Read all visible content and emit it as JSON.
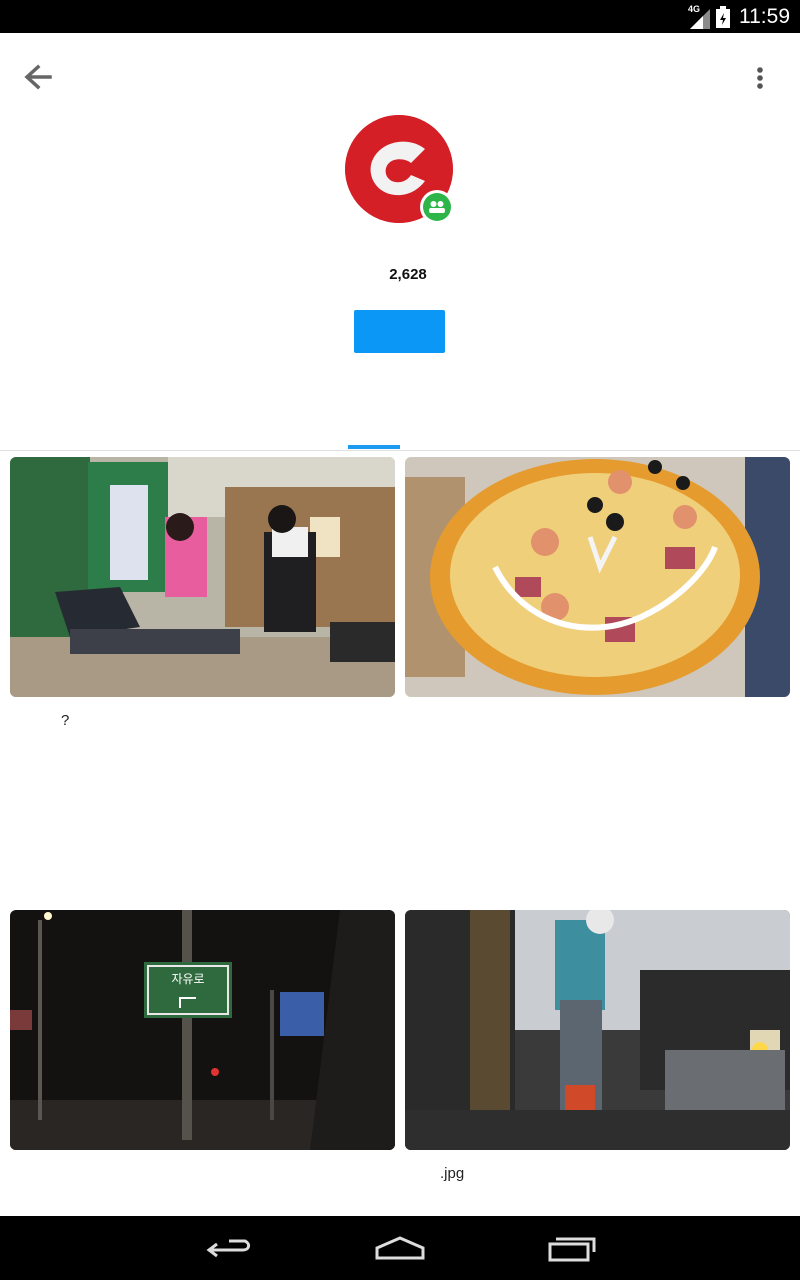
{
  "status_bar": {
    "network": "4G",
    "time": "11:59"
  },
  "profile": {
    "avatar_icon": "brand-logo-icon",
    "badge_icon": "group-icon",
    "count": "2,628",
    "follow_button_label": ""
  },
  "grid": {
    "items": [
      {
        "caption": "?",
        "image": "classroom-photo"
      },
      {
        "caption": "",
        "image": "pizza-photo"
      },
      {
        "caption": "",
        "image": "night-street-photo"
      },
      {
        "caption": ".jpg",
        "image": "dark-classroom-photo"
      }
    ]
  },
  "colors": {
    "accent": "#0a97f5",
    "tab_indicator": "#1e9bf0",
    "avatar_red": "#d41f26",
    "badge_green": "#2db54a"
  }
}
